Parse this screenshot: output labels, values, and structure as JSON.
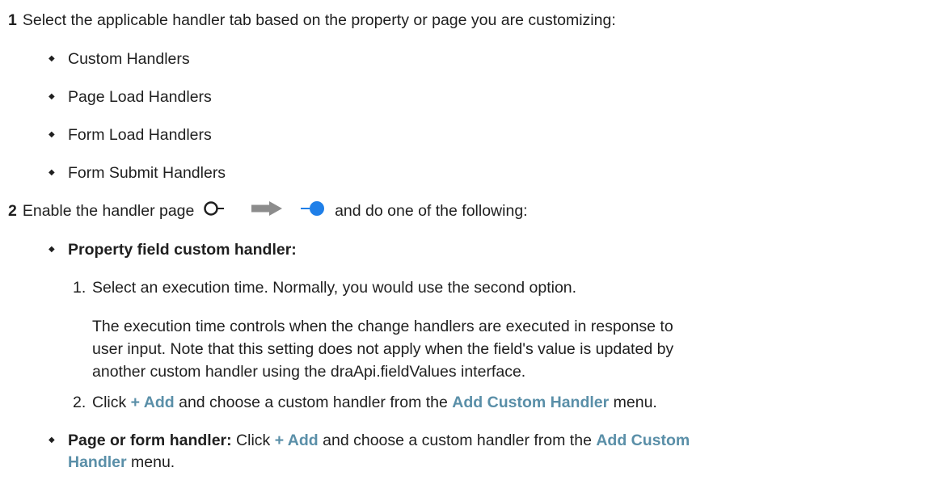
{
  "step1": {
    "number": "1",
    "text": "Select the applicable handler tab based on the property or page you are customizing:",
    "bullets": [
      "Custom Handlers",
      "Page Load Handlers",
      "Form Load Handlers",
      "Form Submit Handlers"
    ]
  },
  "step2": {
    "number": "2",
    "text_before": "Enable the handler page",
    "text_after": "and do one of the following:",
    "toggle_icons": [
      "toggle-off-icon",
      "arrow-right-icon",
      "toggle-on-icon"
    ],
    "property": {
      "title": "Property field custom handler:",
      "item1_number": "1.",
      "item1_text": "Select an execution time. Normally, you would use the second option.",
      "item1_para_line1": "The execution time controls when the change handlers are executed in response to",
      "item1_para_line2": "user input. Note that this setting does not apply when the field's value is updated by",
      "item1_para_line3": "another custom handler using the draApi.fieldValues interface.",
      "item2_number": "2.",
      "item2_click": "Click",
      "item2_add": "+ Add",
      "item2_mid": "and choose a custom handler from the",
      "item2_menu": "Add Custom Handler",
      "item2_end": "menu."
    },
    "page_form": {
      "title": "Page or form handler:",
      "click": "Click",
      "add": "+ Add",
      "mid": "and choose a custom handler from the",
      "menu_line1": "Add Custom",
      "menu_line2": "Handler",
      "end": "menu."
    }
  },
  "colors": {
    "ui_text": "#5a8fa8",
    "toggle_on": "#1f7fe8",
    "arrow": "#8c8c8c"
  }
}
